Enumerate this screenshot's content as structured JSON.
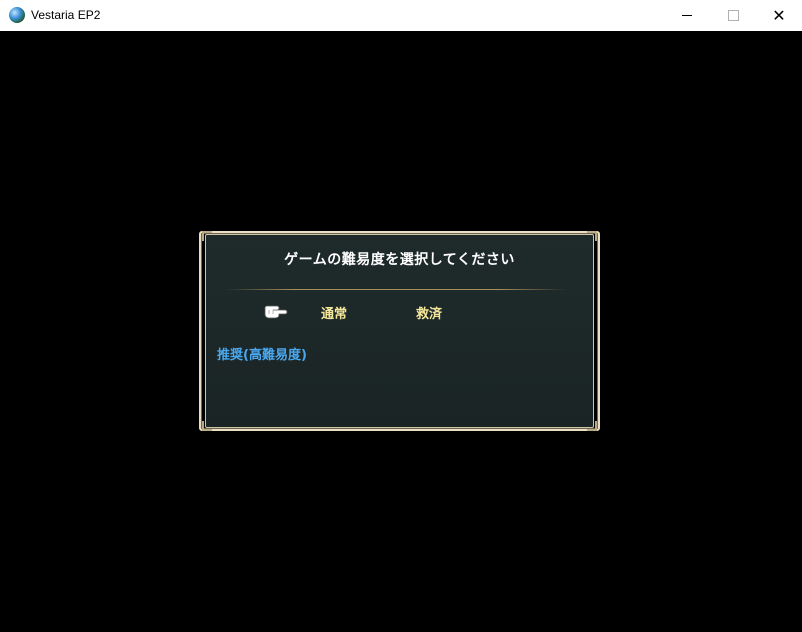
{
  "window": {
    "title": "Vestaria EP2",
    "icon": "globe-icon",
    "controls": {
      "minimize": "minimize-icon",
      "maximize": "maximize-icon",
      "close": "✕"
    }
  },
  "dialog": {
    "title": "ゲームの難易度を選択してください",
    "cursor_icon": "pointing-hand-icon",
    "options": [
      {
        "label": "通常",
        "selected": true
      },
      {
        "label": "救済",
        "selected": false
      }
    ],
    "hint": "推奨(高難易度)",
    "colors": {
      "option": "#f5e79a",
      "hint": "#4aa8ee",
      "background": "#1d2828",
      "border": "#e9dfc4"
    }
  }
}
